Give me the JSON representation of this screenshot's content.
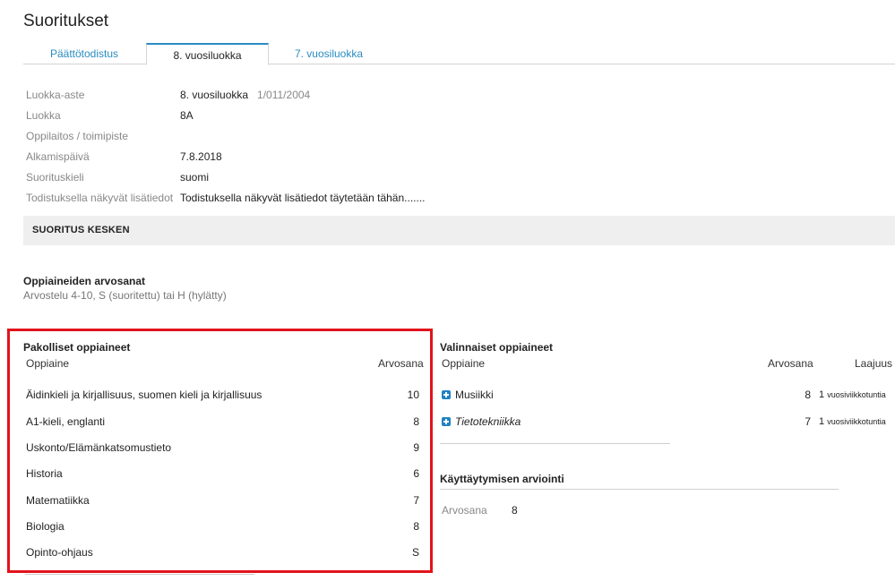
{
  "page": {
    "title": "Suoritukset"
  },
  "tabs": [
    {
      "label": "Päättötodistus"
    },
    {
      "label": "8. vuosiluokka"
    },
    {
      "label": "7. vuosiluokka"
    }
  ],
  "info": [
    {
      "label": "Luokka-aste",
      "value": "8. vuosiluokka",
      "extra": "1/011/2004"
    },
    {
      "label": "Luokka",
      "value": "8A"
    },
    {
      "label": "Oppilaitos / toimipiste",
      "value": ""
    },
    {
      "label": "Alkamispäivä",
      "value": "7.8.2018"
    },
    {
      "label": "Suorituskieli",
      "value": "suomi"
    },
    {
      "label": "Todistuksella näkyvät lisätiedot",
      "value": "Todistuksella näkyvät lisätiedot täytetään tähän......."
    }
  ],
  "status": {
    "text": "SUORITUS KESKEN"
  },
  "grades": {
    "title": "Oppiaineiden arvosanat",
    "subtitle": "Arvostelu 4-10, S (suoritettu) tai H (hylätty)"
  },
  "mandatory": {
    "title": "Pakolliset oppiaineet",
    "col_subject": "Oppiaine",
    "col_grade": "Arvosana",
    "rows": [
      {
        "subject": "Äidinkieli ja kirjallisuus, suomen kieli ja kirjallisuus",
        "grade": "10"
      },
      {
        "subject": "A1-kieli, englanti",
        "grade": "8"
      },
      {
        "subject": "Uskonto/Elämänkatsomustieto",
        "grade": "9"
      },
      {
        "subject": "Historia",
        "grade": "6"
      },
      {
        "subject": "Matematiikka",
        "grade": "7"
      },
      {
        "subject": "Biologia",
        "grade": "8"
      },
      {
        "subject": "Opinto-ohjaus",
        "grade": "S"
      }
    ]
  },
  "optional": {
    "title": "Valinnaiset oppiaineet",
    "col_subject": "Oppiaine",
    "col_grade": "Arvosana",
    "col_extent": "Laajuus",
    "rows": [
      {
        "subject": "Musiikki",
        "grade": "8",
        "extent": "1",
        "unit": "vuosiviikkotuntia",
        "icon": "plus-icon"
      },
      {
        "subject": "Tietotekniikka",
        "grade": "7",
        "extent": "1",
        "unit": "vuosiviikkotuntia",
        "icon": "plus-icon"
      }
    ]
  },
  "behaviour": {
    "title": "Käyttäytymisen arviointi",
    "label": "Arvosana",
    "value": "8"
  },
  "colors": {
    "accent": "#2a8cc2",
    "highlight": "#e2131b",
    "status_bg": "#efefef"
  }
}
